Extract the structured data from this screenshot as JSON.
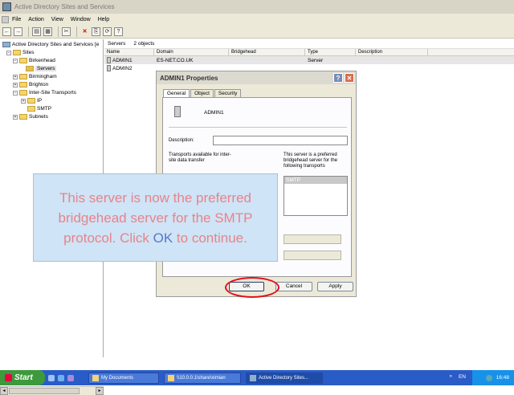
{
  "window": {
    "title": "Active Directory Sites and Services"
  },
  "menu": {
    "items": [
      "File",
      "Action",
      "View",
      "Window",
      "Help"
    ]
  },
  "toolbar": {
    "icons": [
      "back-arrow-icon",
      "forward-arrow-icon",
      "up-folder-icon",
      "properties-icon",
      "cut-icon",
      "delete-icon",
      "export-icon",
      "refresh-icon",
      "help-icon"
    ]
  },
  "tree": {
    "root": "Active Directory Sites and Services [e",
    "items": [
      {
        "label": "Sites",
        "level": 1
      },
      {
        "label": "Birkenhead",
        "level": 2
      },
      {
        "label": "Servers",
        "level": 3,
        "selected": true
      },
      {
        "label": "Birmingham",
        "level": 2
      },
      {
        "label": "Brighton",
        "level": 2
      },
      {
        "label": "Inter-Site Transports",
        "level": 2
      },
      {
        "label": "IP",
        "level": 3
      },
      {
        "label": "SMTP",
        "level": 3
      },
      {
        "label": "Subnets",
        "level": 2
      }
    ]
  },
  "list": {
    "header_title": "Servers",
    "header_count": "2 objects",
    "columns": [
      "Name",
      "Domain",
      "Bridgehead",
      "Type",
      "Description"
    ],
    "rows": [
      {
        "name": "ADMIN1",
        "domain": "ES-NET.CO.UK",
        "bridgehead": "",
        "type": "Server"
      },
      {
        "name": "ADMIN2",
        "domain": "",
        "bridgehead": "",
        "type": ""
      }
    ]
  },
  "dialog": {
    "title": "ADMIN1 Properties",
    "tabs": [
      "General",
      "Object",
      "Security"
    ],
    "server_name": "ADMIN1",
    "description_label": "Description:",
    "transports_label": "Transports available for inter-site data transfer",
    "preferred_label": "This server is a preferred bridgehead server for the following transports",
    "preferred_items": [
      "SMTP"
    ],
    "buttons": {
      "ok": "OK",
      "cancel": "Cancel",
      "apply": "Apply"
    }
  },
  "callout": {
    "text_before": "This server is now the preferred bridgehead server for the SMTP protocol. Click ",
    "ok": "OK",
    "text_after": " to continue."
  },
  "taskbar": {
    "start": "Start",
    "tasks": [
      "My Documents",
      "\\\\10.0.0.1\\share\\ximian",
      "Active Directory Sites..."
    ],
    "lang": "EN",
    "time": "16:48"
  },
  "colors": {
    "callout_text": "#e8838b",
    "callout_ok": "#5b78c6",
    "callout_bg": "#cfe4f6",
    "highlight_ring": "#e0101a"
  }
}
